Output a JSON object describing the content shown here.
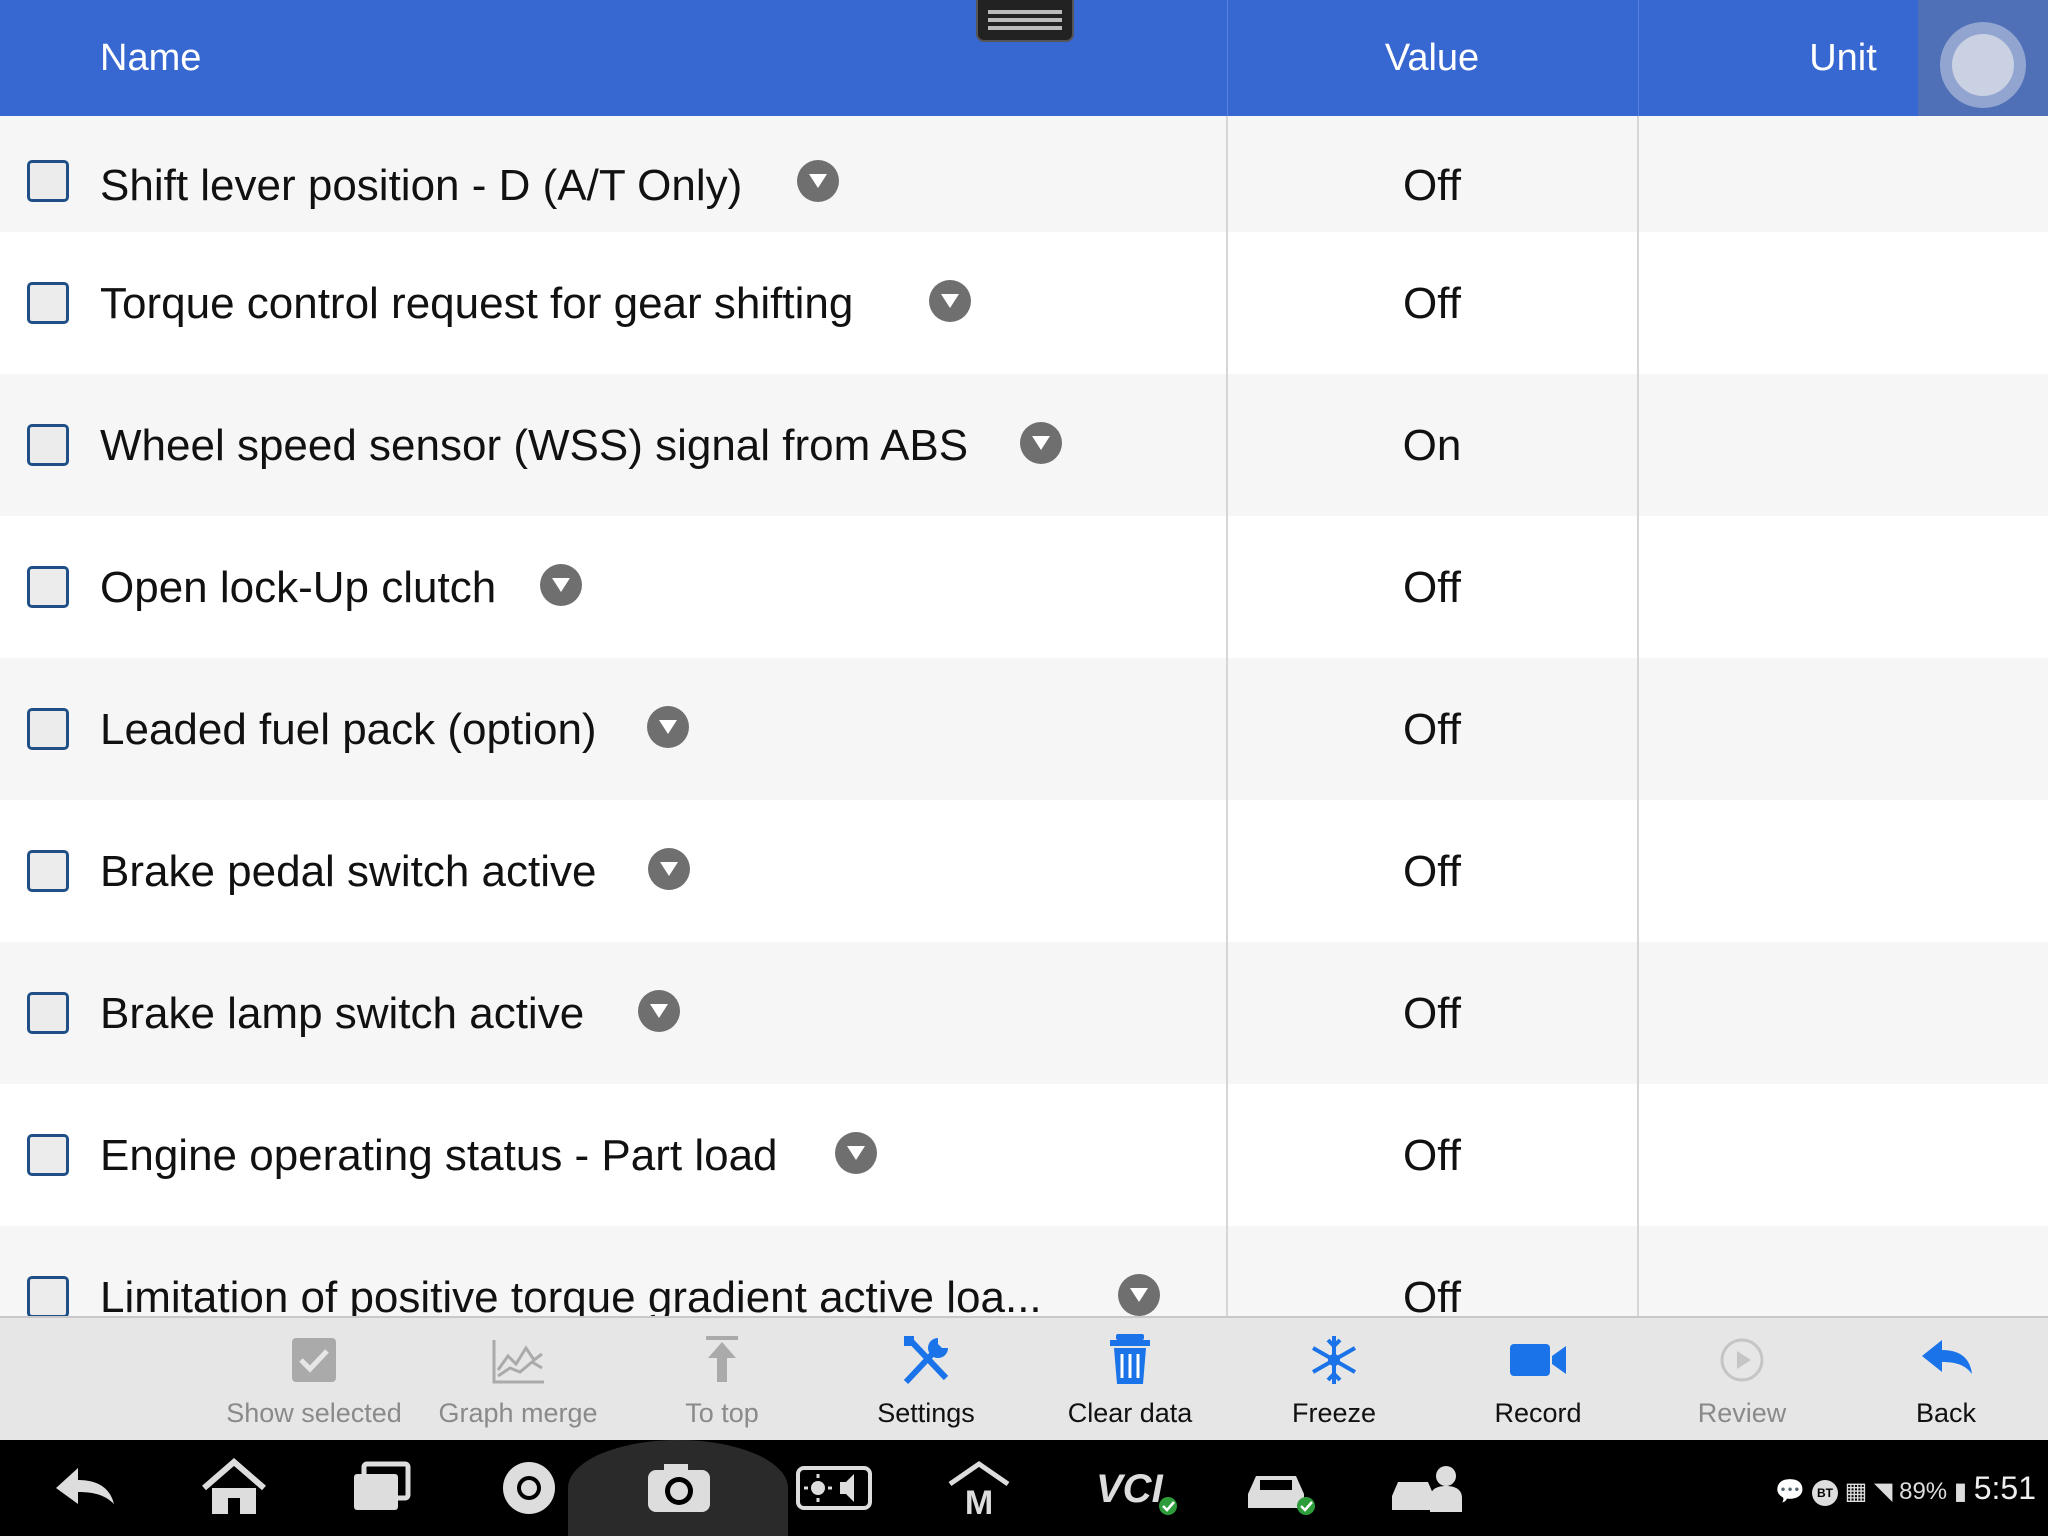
{
  "header": {
    "name": "Name",
    "value": "Value",
    "unit": "Unit"
  },
  "rows": [
    {
      "name": "Shift lever position - D (A/T Only)",
      "value": "Off",
      "unit": ""
    },
    {
      "name": "Torque control request for gear shifting",
      "value": "Off",
      "unit": ""
    },
    {
      "name": "Wheel speed sensor (WSS) signal from ABS",
      "value": "On",
      "unit": ""
    },
    {
      "name": "Open lock-Up clutch",
      "value": "Off",
      "unit": ""
    },
    {
      "name": "Leaded fuel pack (option)",
      "value": "Off",
      "unit": ""
    },
    {
      "name": "Brake pedal switch active",
      "value": "Off",
      "unit": ""
    },
    {
      "name": "Brake lamp switch active",
      "value": "Off",
      "unit": ""
    },
    {
      "name": "Engine operating status - Part load",
      "value": "Off",
      "unit": ""
    },
    {
      "name": "Limitation of positive torque gradient active loa...",
      "value": "Off",
      "unit": ""
    }
  ],
  "toolbar": {
    "show_selected": "Show selected",
    "graph_merge": "Graph merge",
    "to_top": "To top",
    "settings": "Settings",
    "clear_data": "Clear data",
    "freeze": "Freeze",
    "record": "Record",
    "review": "Review",
    "back": "Back"
  },
  "status_bar": {
    "battery": "89%",
    "time": "5:51",
    "bt": "BT"
  },
  "colors": {
    "header": "#3767d0",
    "accent": "#1a73e8"
  }
}
